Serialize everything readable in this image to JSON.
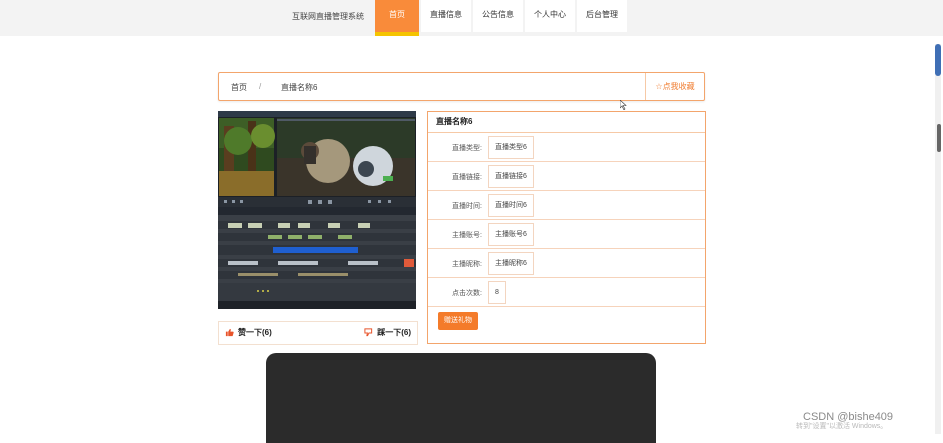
{
  "header": {
    "site_title": "互联网直播管理系统",
    "nav": [
      {
        "label": "首页",
        "active": true
      },
      {
        "label": "直播信息",
        "active": false
      },
      {
        "label": "公告信息",
        "active": false
      },
      {
        "label": "个人中心",
        "active": false
      },
      {
        "label": "后台管理",
        "active": false
      }
    ]
  },
  "breadcrumb": {
    "home": "首页",
    "separator": "/",
    "current": "直播名称6",
    "favorite_label": "点我收藏",
    "favorite_icon": "star-outline-icon"
  },
  "reactions": {
    "like_label": "赞一下(6)",
    "dislike_label": "踩一下(6)",
    "like_icon": "thumbs-up-icon",
    "dislike_icon": "thumbs-down-icon"
  },
  "detail": {
    "title": "直播名称6",
    "fields": [
      {
        "label": "直播类型:",
        "value": "直播类型6"
      },
      {
        "label": "直播链接:",
        "value": "直播链接6"
      },
      {
        "label": "直播时间:",
        "value": "直播时间6"
      },
      {
        "label": "主播账号:",
        "value": "主播账号6"
      },
      {
        "label": "主播昵称:",
        "value": "主播昵称6"
      },
      {
        "label": "点击次数:",
        "value": "8"
      }
    ],
    "gift_button": "赠送礼物"
  },
  "overlay": {
    "watermark": "CSDN @bishe409",
    "activate_text": "转到\"设置\"以激活 Windows。"
  },
  "colors": {
    "accent": "#f98b3a",
    "accent_underline": "#f5c400",
    "border": "#f3a56c",
    "button": "#f47b2a"
  }
}
